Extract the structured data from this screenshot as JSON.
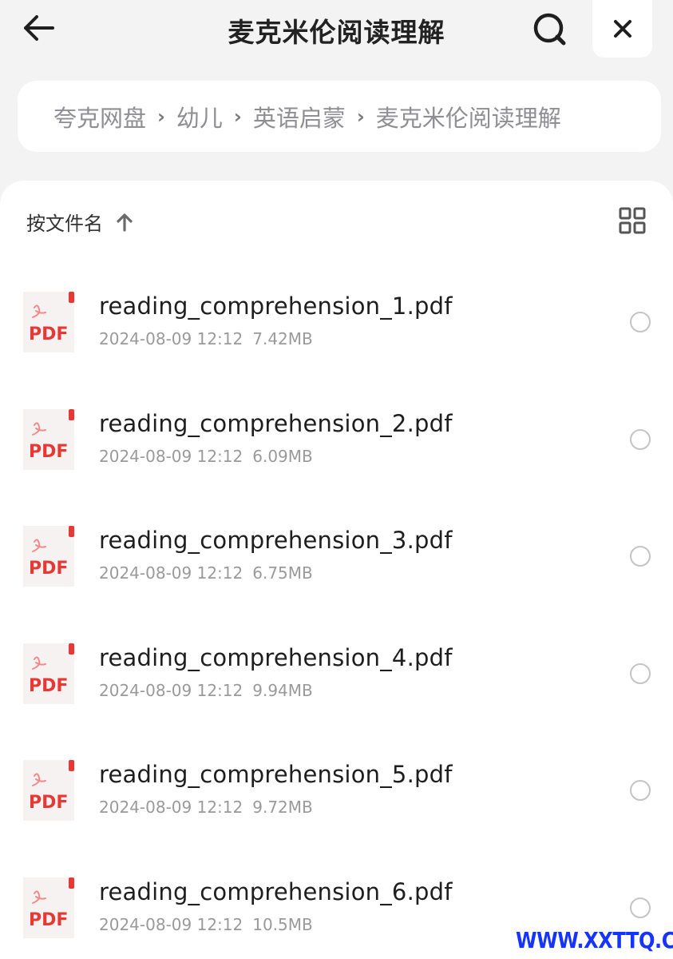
{
  "header": {
    "title": "麦克米伦阅读理解",
    "back_icon": "arrow-left-icon",
    "search_icon": "search-icon",
    "close_icon": "close-icon"
  },
  "breadcrumb": {
    "items": [
      "夸克网盘",
      "幼儿",
      "英语启蒙",
      "麦克米伦阅读理解"
    ],
    "separator": "›"
  },
  "toolbar": {
    "sort_label": "按文件名",
    "sort_icon": "arrow-up-icon",
    "view_toggle_icon": "grid-view-icon"
  },
  "files": [
    {
      "name": "reading_comprehension_1.pdf",
      "date": "2024-08-09 12:12",
      "size": "7.42MB",
      "type_label": "PDF"
    },
    {
      "name": "reading_comprehension_2.pdf",
      "date": "2024-08-09 12:12",
      "size": "6.09MB",
      "type_label": "PDF"
    },
    {
      "name": "reading_comprehension_3.pdf",
      "date": "2024-08-09 12:12",
      "size": "6.75MB",
      "type_label": "PDF"
    },
    {
      "name": "reading_comprehension_4.pdf",
      "date": "2024-08-09 12:12",
      "size": "9.94MB",
      "type_label": "PDF"
    },
    {
      "name": "reading_comprehension_5.pdf",
      "date": "2024-08-09 12:12",
      "size": "9.72MB",
      "type_label": "PDF"
    },
    {
      "name": "reading_comprehension_6.pdf",
      "date": "2024-08-09 12:12",
      "size": "10.5MB",
      "type_label": "PDF"
    }
  ],
  "watermark": "WWW.XXTTQ.COM",
  "colors": {
    "background": "#f3f3f3",
    "surface": "#ffffff",
    "pdf_red": "#e53935",
    "watermark_blue": "#1534ff"
  }
}
